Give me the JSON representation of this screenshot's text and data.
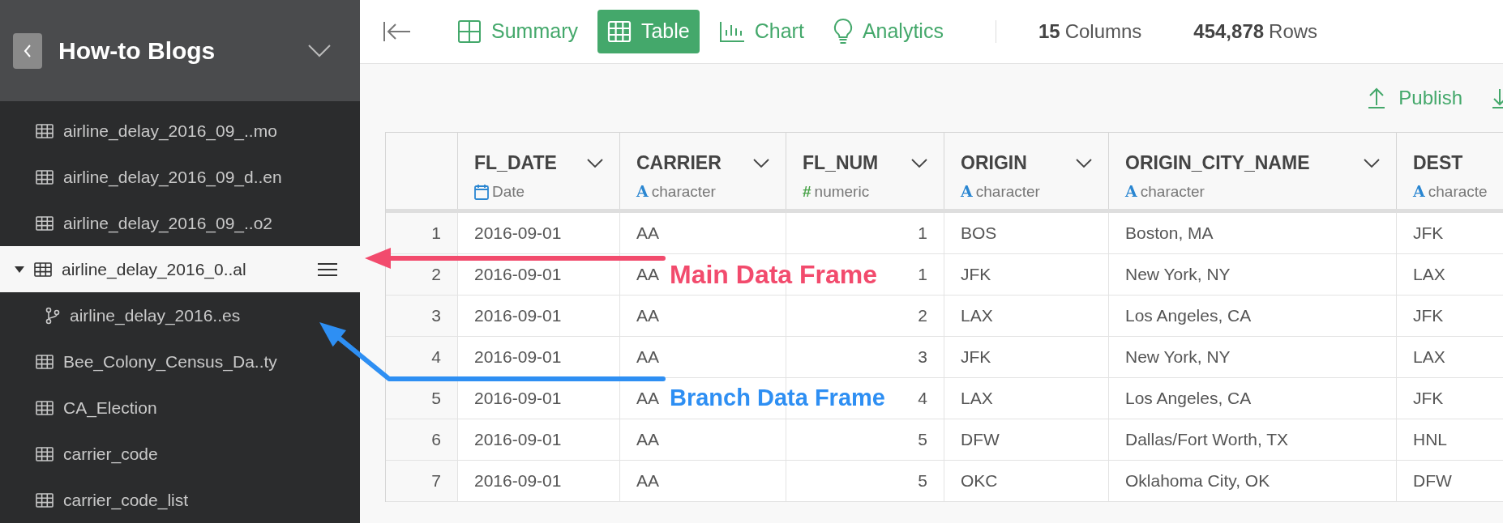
{
  "sidebar": {
    "title": "How-to Blogs",
    "items": [
      {
        "label": "airline_delay_2016_09_..mo",
        "kind": "table",
        "selected": false
      },
      {
        "label": "airline_delay_2016_09_d..en",
        "kind": "table",
        "selected": false
      },
      {
        "label": "airline_delay_2016_09_..o2",
        "kind": "table",
        "selected": false
      },
      {
        "label": "airline_delay_2016_0..al",
        "kind": "table",
        "selected": true,
        "expanded": true,
        "children": [
          {
            "label": "airline_delay_2016..es",
            "kind": "branch",
            "selected": false
          }
        ]
      },
      {
        "label": "Bee_Colony_Census_Da..ty",
        "kind": "table",
        "selected": false
      },
      {
        "label": "CA_Election",
        "kind": "table",
        "selected": false
      },
      {
        "label": "carrier_code",
        "kind": "table",
        "selected": false
      },
      {
        "label": "carrier_code_list",
        "kind": "table",
        "selected": false
      }
    ]
  },
  "tabs": [
    {
      "label": "Summary",
      "kind": "summary",
      "selected": false
    },
    {
      "label": "Table",
      "kind": "table",
      "selected": true
    },
    {
      "label": "Chart",
      "kind": "chart",
      "selected": false
    },
    {
      "label": "Analytics",
      "kind": "analytics",
      "selected": false
    }
  ],
  "stats": [
    {
      "value": "15",
      "label": "Columns"
    },
    {
      "value": "454,878",
      "label": "Rows"
    }
  ],
  "actions": [
    {
      "label": "Publish",
      "kind": "publish"
    },
    {
      "kind": "download"
    }
  ],
  "table": {
    "columns": [
      {
        "name": "FL_DATE",
        "type": "Date",
        "kind": "date"
      },
      {
        "name": "CARRIER",
        "type": "character",
        "kind": "character",
        "icon": "A"
      },
      {
        "name": "FL_NUM",
        "type": "numeric",
        "kind": "numeric",
        "icon": "#"
      },
      {
        "name": "ORIGIN",
        "type": "character",
        "kind": "character",
        "icon": "A"
      },
      {
        "name": "ORIGIN_CITY_NAME",
        "type": "character",
        "kind": "character",
        "icon": "A"
      },
      {
        "name": "DEST",
        "type": "characte",
        "kind": "character",
        "icon": "A"
      }
    ],
    "rows": [
      {
        "number": "1",
        "cells": [
          "2016-09-01",
          "AA",
          "1",
          "BOS",
          "Boston, MA",
          "JFK"
        ]
      },
      {
        "number": "2",
        "cells": [
          "2016-09-01",
          "AA",
          "1",
          "JFK",
          "New York, NY",
          "LAX"
        ]
      },
      {
        "number": "3",
        "cells": [
          "2016-09-01",
          "AA",
          "2",
          "LAX",
          "Los Angeles, CA",
          "JFK"
        ]
      },
      {
        "number": "4",
        "cells": [
          "2016-09-01",
          "AA",
          "3",
          "JFK",
          "New York, NY",
          "LAX"
        ]
      },
      {
        "number": "5",
        "cells": [
          "2016-09-01",
          "AA",
          "4",
          "LAX",
          "Los Angeles, CA",
          "JFK"
        ]
      },
      {
        "number": "6",
        "cells": [
          "2016-09-01",
          "AA",
          "5",
          "DFW",
          "Dallas/Fort Worth, TX",
          "HNL"
        ]
      },
      {
        "number": "7",
        "cells": [
          "2016-09-01",
          "AA",
          "5",
          "OKC",
          "Oklahoma City, OK",
          "DFW"
        ]
      }
    ]
  },
  "annotations": [
    {
      "text": "Main Data Frame",
      "color": "#f24b6d"
    },
    {
      "text": "Branch Data Frame",
      "color": "#2e8ff3"
    }
  ]
}
